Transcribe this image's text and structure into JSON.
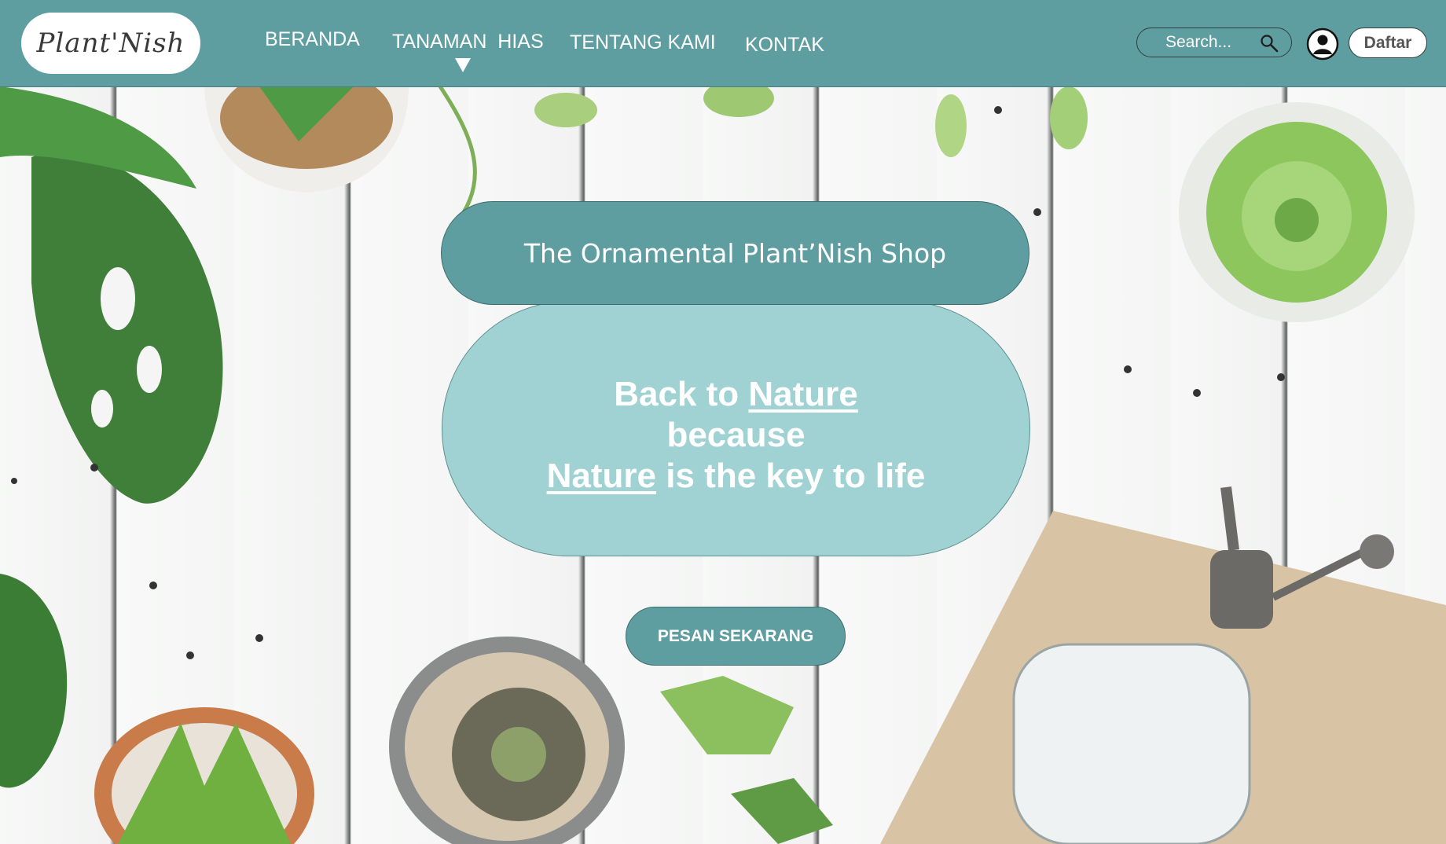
{
  "header": {
    "logo_text": "Plant'Nish",
    "nav": [
      {
        "label": "BERANDA"
      },
      {
        "label": "TANAMAN  HIAS"
      },
      {
        "label": "TENTANG KAMI"
      },
      {
        "label": "KONTAK"
      }
    ],
    "search_placeholder": "Search...",
    "signup_label": "Daftar",
    "icons": {
      "search": "magnifier-icon",
      "user": "user-circle-icon",
      "dropdown": "triangle-down-icon"
    }
  },
  "hero": {
    "title": "The Ornamental Plant’Nish Shop",
    "tagline_line1_prefix": "Back to ",
    "tagline_line1_link": "Nature",
    "tagline_line2": "because",
    "tagline_line3_link": "Nature",
    "tagline_line3_suffix": " is the key to life",
    "cta_label": "PESAN SEKARANG"
  },
  "colors": {
    "primary": "#5f9ea0",
    "light_teal": "#a0d2d3",
    "white": "#ffffff"
  }
}
